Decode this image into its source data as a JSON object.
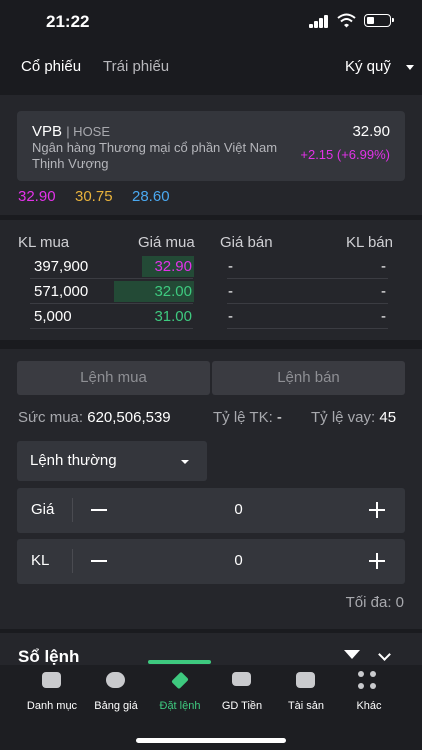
{
  "status": {
    "time": "21:22"
  },
  "tabs": {
    "stock": "Cổ phiếu",
    "bond": "Trái phiếu",
    "margin": "Ký quỹ"
  },
  "stock": {
    "symbol": "VPB",
    "exchange": "| HOSE",
    "name": "Ngân hàng Thương mại cổ phần Việt Nam Thịnh Vượng",
    "price": "32.90",
    "change": "+2.15 (+6.99%)"
  },
  "price_refs": {
    "ceiling": "32.90",
    "reference": "30.75",
    "floor": "28.60"
  },
  "order_book": {
    "headers": {
      "bid_qty": "KL mua",
      "bid_price": "Giá mua",
      "ask_price": "Giá bán",
      "ask_qty": "KL bán"
    },
    "rows": [
      {
        "bid_qty": "397,900",
        "bid_price": "32.90",
        "ask_price": "-",
        "ask_qty": "-"
      },
      {
        "bid_qty": "571,000",
        "bid_price": "32.00",
        "ask_price": "-",
        "ask_qty": "-"
      },
      {
        "bid_qty": "5,000",
        "bid_price": "31.00",
        "ask_price": "-",
        "ask_qty": "-"
      }
    ]
  },
  "order": {
    "buy_label": "Lệnh mua",
    "sell_label": "Lệnh bán",
    "buying_power_label": "Sức mua:",
    "buying_power": "620,506,539",
    "tk_ratio_label": "Tỷ lệ TK:",
    "tk_ratio": "-",
    "loan_ratio_label": "Tỷ lệ vay:",
    "loan_ratio": "45",
    "order_type": "Lệnh thường",
    "price_label": "Giá",
    "price_value": "0",
    "qty_label": "KL",
    "qty_value": "0",
    "max_label": "Tối đa: 0"
  },
  "order_log": {
    "title": "Sổ lệnh"
  },
  "bottom_nav": [
    {
      "label": "Danh mục"
    },
    {
      "label": "Bảng giá"
    },
    {
      "label": "Đặt lệnh"
    },
    {
      "label": "GD Tiền"
    },
    {
      "label": "Tài sản"
    },
    {
      "label": "Khác"
    }
  ],
  "colors": {
    "ceiling": "#e232e8",
    "reference": "#e8b23c",
    "floor": "#4aa8f0",
    "up": "#3ec97f",
    "active_nav": "#3ec97f"
  }
}
